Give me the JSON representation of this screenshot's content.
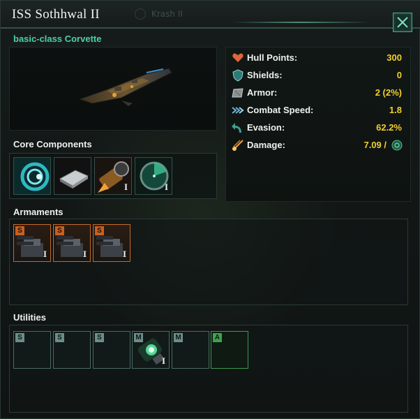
{
  "window": {
    "title": "ISS Sothhwal II",
    "ghost_tab": "Krash II",
    "subtitle": "basic-class Corvette",
    "close_icon": "close-x-icon"
  },
  "stats": [
    {
      "icon": "heart-icon",
      "label": "Hull Points:",
      "value": "300"
    },
    {
      "icon": "shield-icon",
      "label": "Shields:",
      "value": "0"
    },
    {
      "icon": "armor-plate-icon",
      "label": "Armor:",
      "value": "2 (2%)"
    },
    {
      "icon": "speed-arrows-icon",
      "label": "Combat Speed:",
      "value": "1.8"
    },
    {
      "icon": "evasion-arrow-icon",
      "label": "Evasion:",
      "value": "62.2%"
    },
    {
      "icon": "damage-projectile-icon",
      "label": "Damage:",
      "value": "7.09 /"
    }
  ],
  "damage_extra_icon": "target-reticle-icon",
  "sections": {
    "core": "Core Components",
    "armaments": "Armaments",
    "utilities": "Utilities"
  },
  "core_components": [
    {
      "icon": "hyperdrive-icon",
      "tier": ""
    },
    {
      "icon": "computer-chip-icon",
      "tier": ""
    },
    {
      "icon": "thruster-icon",
      "tier": "I"
    },
    {
      "icon": "radar-sensor-icon",
      "tier": "I"
    }
  ],
  "armaments": [
    {
      "size": "S",
      "icon": "mass-driver-turret-icon",
      "tier": "I"
    },
    {
      "size": "S",
      "icon": "mass-driver-turret-icon",
      "tier": "I"
    },
    {
      "size": "S",
      "icon": "mass-driver-turret-icon",
      "tier": "I"
    }
  ],
  "utilities": [
    {
      "size": "S",
      "icon": "",
      "tier": ""
    },
    {
      "size": "S",
      "icon": "",
      "tier": ""
    },
    {
      "size": "S",
      "icon": "",
      "tier": ""
    },
    {
      "size": "M",
      "icon": "reactor-module-icon",
      "tier": "I"
    },
    {
      "size": "M",
      "icon": "",
      "tier": ""
    },
    {
      "size": "A",
      "icon": "",
      "tier": ""
    }
  ],
  "colors": {
    "accent_teal": "#4ad0a8",
    "value_yellow": "#f2cf2b",
    "weapon_orange": "#c8601e",
    "aux_green": "#3da24f"
  }
}
